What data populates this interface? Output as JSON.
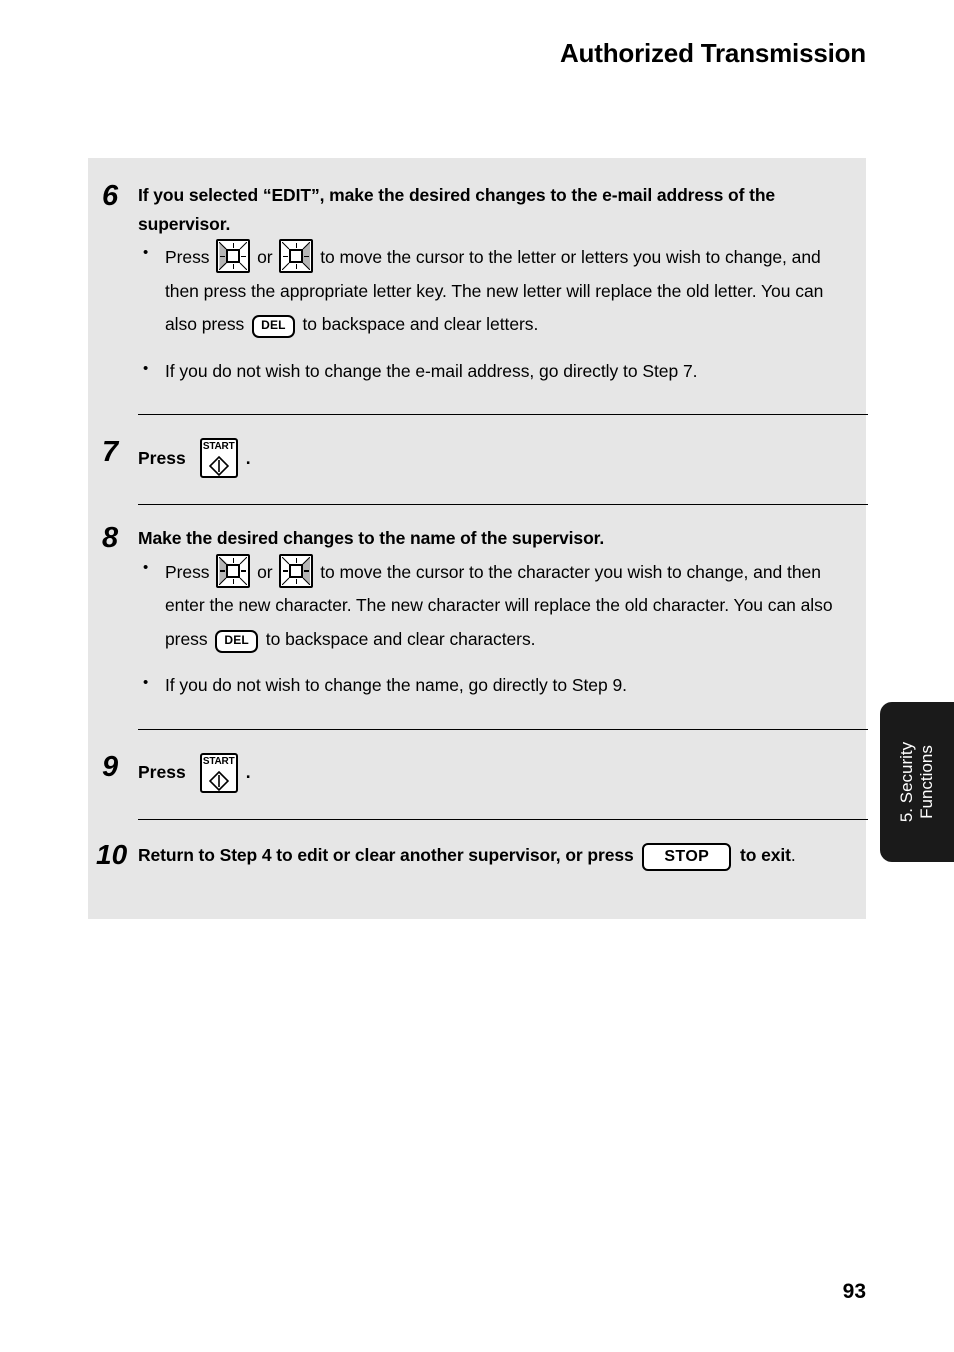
{
  "header": {
    "title": "Authorized Transmission"
  },
  "footer": {
    "page_number": "93"
  },
  "side_tab": {
    "line1": "5. Security",
    "line2": "Functions"
  },
  "keys": {
    "del_label": "DEL",
    "stop_label": "STOP",
    "start_label": "START",
    "cursor_left_name": "cursor-left-key",
    "cursor_right_name": "cursor-right-key"
  },
  "steps": [
    {
      "number": "6",
      "title": "If you selected “EDIT”, make the desired changes to the e-mail address of the supervisor.",
      "bullets": [
        {
          "part1": "Press",
          "mid": "or",
          "part2": "to move the cursor to the letter or letters you wish to change, and then press the appropriate letter key. The new letter will replace the old letter. You can also press",
          "part3": "to backspace and clear letters."
        },
        {
          "text": "If you do not wish to change the e-mail address, go directly to Step 7."
        }
      ]
    },
    {
      "number": "7",
      "press_label": "Press",
      "period": "."
    },
    {
      "number": "8",
      "title": "Make the desired changes to the name of the supervisor.",
      "bullets": [
        {
          "part1": "Press",
          "mid": "or",
          "part2": "to move the cursor to the character you wish to change, and then enter the new character. The new character  will replace the old character. You can also press",
          "part3": "to backspace and clear characters."
        },
        {
          "text": "If you do not wish to change the name, go directly to Step 9."
        }
      ]
    },
    {
      "number": "9",
      "press_label": "Press",
      "period": "."
    },
    {
      "number": "10",
      "title_before": "Return to Step 4 to edit or clear another supervisor, or press",
      "title_after": "to exit",
      "title_end": "."
    }
  ],
  "colors": {
    "panel_background": "#e6e6e6",
    "tab_background": "#1a1a1a",
    "text": "#000000",
    "key_bevel": "#b5b5b5"
  }
}
